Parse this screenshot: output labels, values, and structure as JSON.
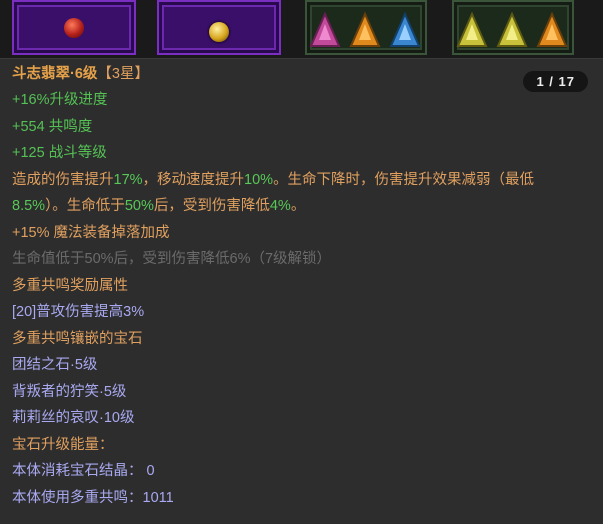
{
  "tooltip": {
    "title": "斗志翡翠·6级",
    "stars": "【3星】",
    "counter": "1 / 17",
    "bonus_upgrade": "+16%升级进度",
    "bonus_resonance": "+554 共鸣度",
    "bonus_combat": "+125 战斗等级",
    "effect_line1_a": "造成的伤害提升",
    "effect_line1_b": "17%",
    "effect_line1_c": "，移动速度提升",
    "effect_line1_d": "10%",
    "effect_line1_e": "。生命下降时，伤害提升效果减弱（最低",
    "effect_line2_a": "8.5%",
    "effect_line2_b": "）。生命低于",
    "effect_line2_c": "50%",
    "effect_line2_d": "后，受到伤害降低",
    "effect_line2_e": "4%",
    "effect_line2_f": "。",
    "magic_find": "+15% 魔法装备掉落加成",
    "locked_effect": "生命值低于50%后，受到伤害降低6%（7级解锁）",
    "resonance_header": "多重共鸣奖励属性",
    "resonance_bonus": "[20]普攻伤害提高3%",
    "socketed_header": "多重共鸣镶嵌的宝石",
    "socketed_gems": [
      "团结之石·5级",
      "背叛者的狞笑·5级",
      "莉莉丝的哀叹·10级"
    ],
    "energy_header": "宝石升级能量：",
    "energy_consumed": "本体消耗宝石结晶： 0",
    "energy_resonance": "本体使用多重共鸣：1011"
  },
  "slot_icons": [
    "red-gem-icon",
    "gold-gem-icon",
    "tri-gem-set-icon",
    "tri-gem-set-icon"
  ],
  "colors": {
    "title": "#e6a24a",
    "bonus_green": "#55c255",
    "effect_orange": "#e0a05f",
    "locked_gray": "#6b6b6b",
    "resonance_blue": "#a9a9f2"
  }
}
